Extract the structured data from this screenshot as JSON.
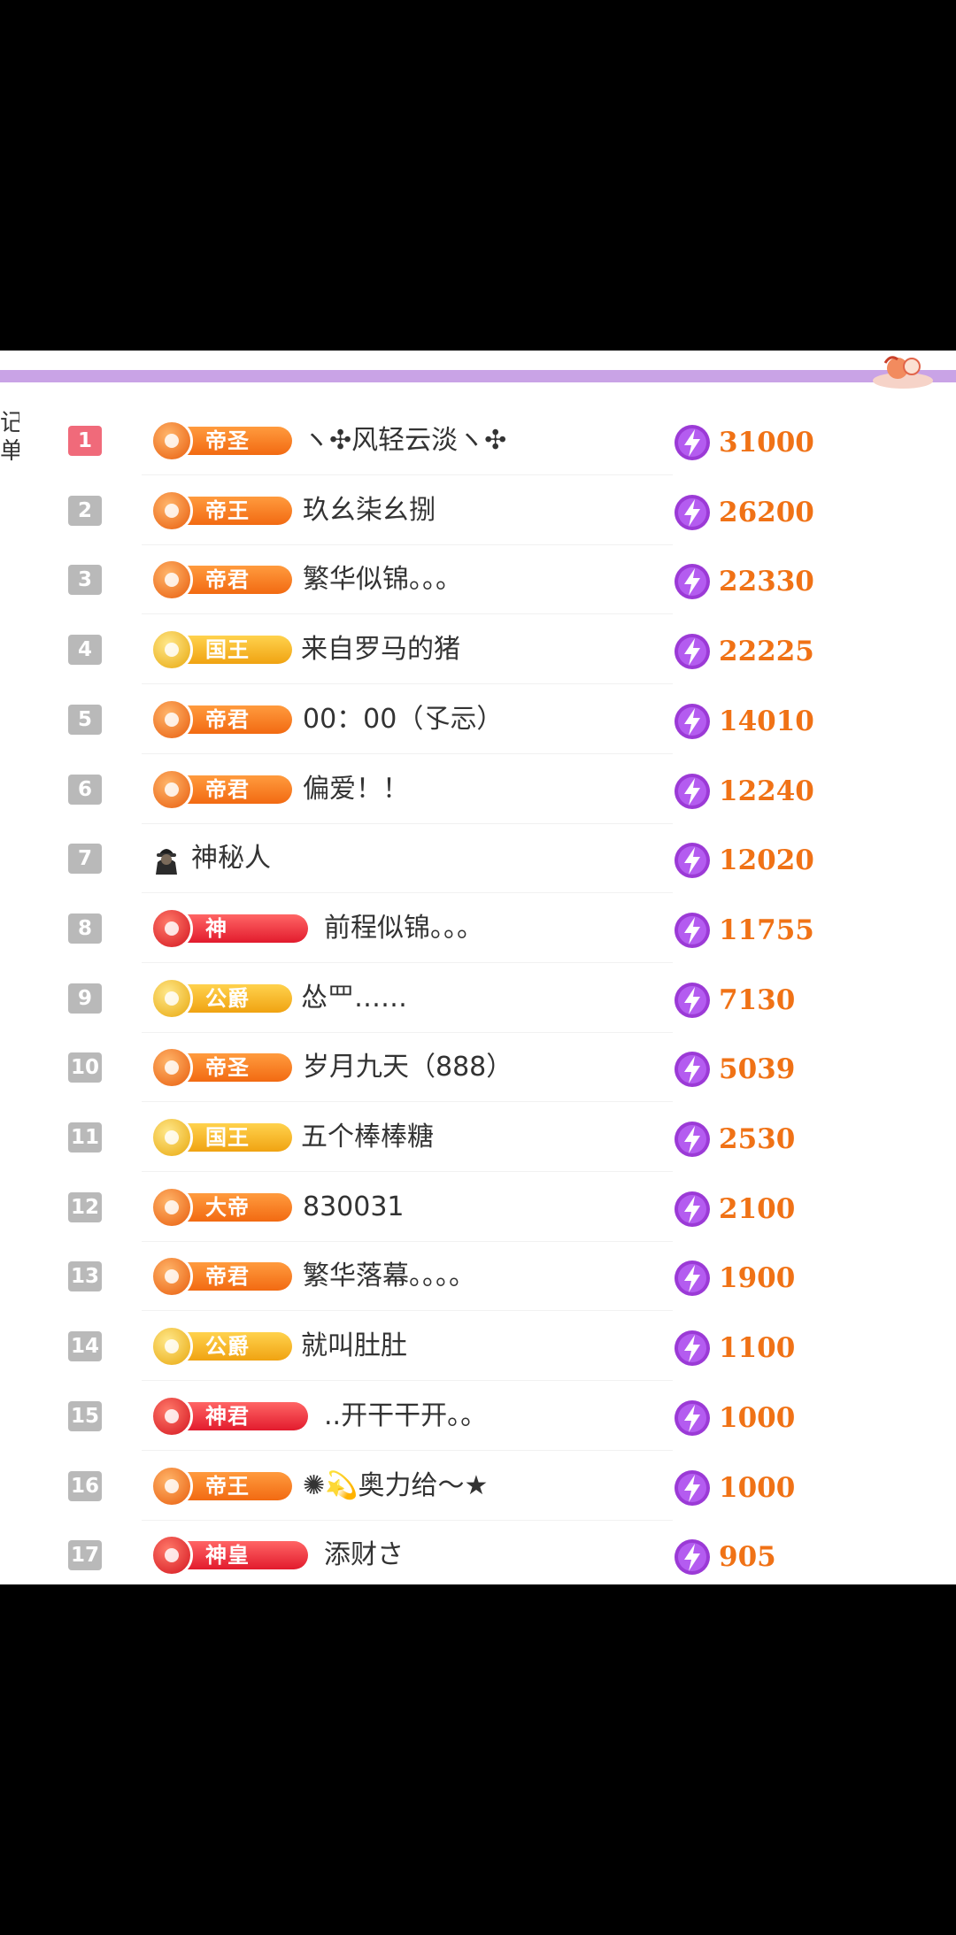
{
  "sidebar": {
    "text": "记单"
  },
  "leaderboard": [
    {
      "rank": "1",
      "badge": "帝圣",
      "tier": "orange",
      "name": "ヽ✣风轻云淡ヽ✣",
      "amount": "31000"
    },
    {
      "rank": "2",
      "badge": "帝王",
      "tier": "orange",
      "name": "玖幺柒幺捌",
      "amount": "26200"
    },
    {
      "rank": "3",
      "badge": "帝君",
      "tier": "orange",
      "name": "繁华似锦。。。",
      "amount": "22330"
    },
    {
      "rank": "4",
      "badge": "国王",
      "tier": "gold",
      "name": "来自罗马的猪",
      "amount": "22225"
    },
    {
      "rank": "5",
      "badge": "帝君",
      "tier": "orange",
      "name": "00：00（孓忈）",
      "amount": "14010"
    },
    {
      "rank": "6",
      "badge": "帝君",
      "tier": "orange",
      "name": "偏爱！！",
      "amount": "12240"
    },
    {
      "rank": "7",
      "badge": "",
      "tier": "mystery",
      "name": "神秘人",
      "amount": "12020"
    },
    {
      "rank": "8",
      "badge": "神",
      "tier": "red",
      "name": "前程似锦。。。",
      "amount": "11755"
    },
    {
      "rank": "9",
      "badge": "公爵",
      "tier": "gold",
      "name": "怂罒……",
      "amount": "7130"
    },
    {
      "rank": "10",
      "badge": "帝圣",
      "tier": "orange",
      "name": "岁月九天（888）",
      "amount": "5039"
    },
    {
      "rank": "11",
      "badge": "国王",
      "tier": "gold",
      "name": "五个棒棒糖",
      "amount": "2530"
    },
    {
      "rank": "12",
      "badge": "大帝",
      "tier": "orange",
      "name": "830031",
      "amount": "2100"
    },
    {
      "rank": "13",
      "badge": "帝君",
      "tier": "orange",
      "name": "繁华落幕。。。。",
      "amount": "1900"
    },
    {
      "rank": "14",
      "badge": "公爵",
      "tier": "gold",
      "name": "就叫肚肚",
      "amount": "1100"
    },
    {
      "rank": "15",
      "badge": "神君",
      "tier": "red",
      "name": "..开干干开。。",
      "amount": "1000"
    },
    {
      "rank": "16",
      "badge": "帝王",
      "tier": "orange",
      "name": "✺💫奥力给～★",
      "amount": "1000"
    },
    {
      "rank": "17",
      "badge": "神皇",
      "tier": "red",
      "name": "添财さ",
      "amount": "905"
    }
  ],
  "icons": {
    "coin": "purple-lightning-coin-icon",
    "mystery": "hooded-mystery-avatar-icon",
    "mascot": "mascot-sticker-icon"
  },
  "colors": {
    "accent_bar": "#c9a3e6",
    "amount": "#f07216",
    "rank_top": "#f06a7a",
    "rank_default": "#b9b9b9",
    "coin": "#9b3ad6"
  }
}
